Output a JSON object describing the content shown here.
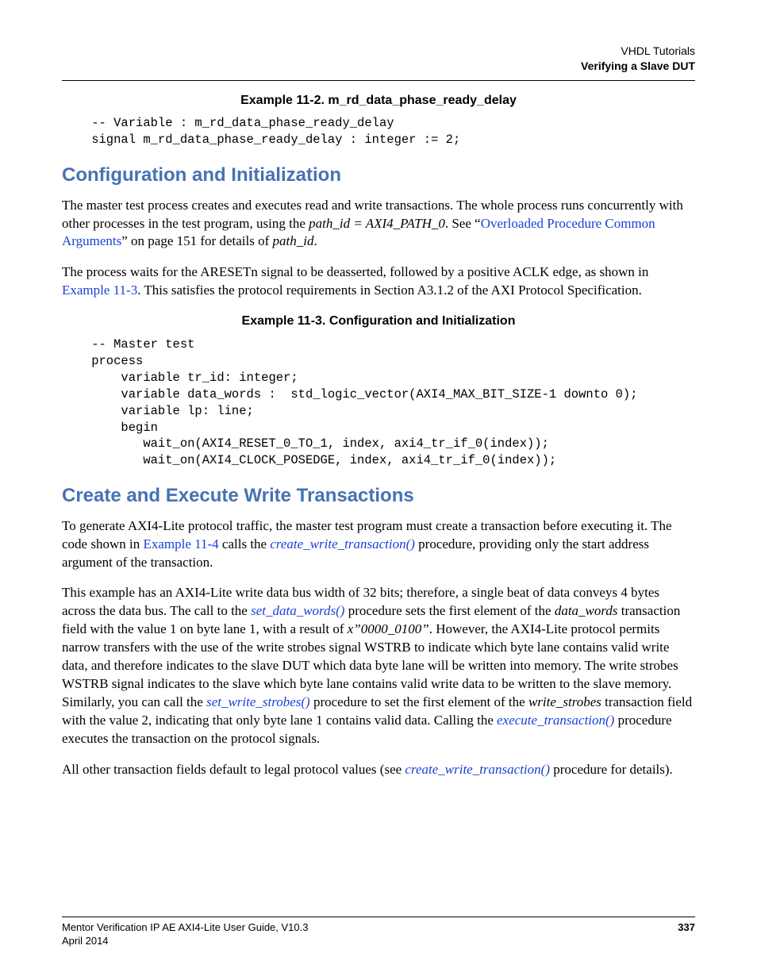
{
  "header": {
    "line1": "VHDL Tutorials",
    "line2": "Verifying a Slave DUT"
  },
  "example1": {
    "caption": "Example 11-2. m_rd_data_phase_ready_delay",
    "code": "    -- Variable : m_rd_data_phase_ready_delay\n    signal m_rd_data_phase_ready_delay : integer := 2;"
  },
  "section1": {
    "title": "Configuration and Initialization",
    "para1": {
      "t1": "The master test process creates and executes read and write transactions. The whole process runs concurrently with other processes in the test program, using the ",
      "i1": "path_id = AXI4_PATH_0",
      "t2": ". See “",
      "l1": "Overloaded Procedure Common Arguments",
      "t3": "” on page 151 for details of ",
      "i2": "path_id",
      "t4": "."
    },
    "para2": {
      "t1": "The process waits for the ARESETn signal to be deasserted, followed by a positive ACLK edge, as shown in ",
      "l1": "Example 11-3",
      "t2": ". This satisfies the protocol requirements in Section A3.1.2 of the AXI Protocol Specification."
    }
  },
  "example2": {
    "caption": "Example 11-3. Configuration and Initialization",
    "code": "    -- Master test\n    process\n        variable tr_id: integer;\n        variable data_words :  std_logic_vector(AXI4_MAX_BIT_SIZE-1 downto 0);\n        variable lp: line;\n        begin\n           wait_on(AXI4_RESET_0_TO_1, index, axi4_tr_if_0(index));\n           wait_on(AXI4_CLOCK_POSEDGE, index, axi4_tr_if_0(index));"
  },
  "section2": {
    "title": "Create and Execute Write Transactions",
    "para1": {
      "t1": "To generate AXI4-Lite protocol traffic, the master test program must create a transaction before executing it. The code shown in ",
      "l1": "Example 11-4",
      "t2": " calls the ",
      "l2": "create_write_transaction()",
      "t3": " procedure, providing only the start address argument of the transaction."
    },
    "para2": {
      "t1": "This example has an AXI4-Lite write data bus width of 32 bits; therefore, a single beat of data conveys 4 bytes across the data bus. The call to the ",
      "l1": "set_data_words()",
      "t2": " procedure sets the first element of the ",
      "i1": "data_words",
      "t3": " transaction field with the value 1 on byte lane 1, with a result of ",
      "i2": "x”0000_0100”",
      "t4": ". However, the AXI4-Lite protocol permits narrow transfers with the use of the write strobes signal WSTRB to indicate which byte lane contains valid write data, and therefore indicates to the slave DUT which data byte lane will be written into memory. The write strobes WSTRB signal indicates to the slave which byte lane contains valid write data to be written to the slave memory. Similarly, you can call the ",
      "l2": "set_write_strobes()",
      "t5": " procedure to set the first element of the ",
      "i3": "write_strobes",
      "t6": " transaction field with the value 2, indicating that only byte lane 1 contains valid data. Calling the ",
      "l3": "execute_transaction()",
      "t7": " procedure executes the transaction on the protocol signals."
    },
    "para3": {
      "t1": "All other transaction fields default to legal protocol values (see ",
      "l1": "create_write_transaction()",
      "t2": " procedure for details)."
    }
  },
  "footer": {
    "title": "Mentor Verification IP AE AXI4-Lite User Guide, V10.3",
    "date": "April 2014",
    "page": "337"
  }
}
